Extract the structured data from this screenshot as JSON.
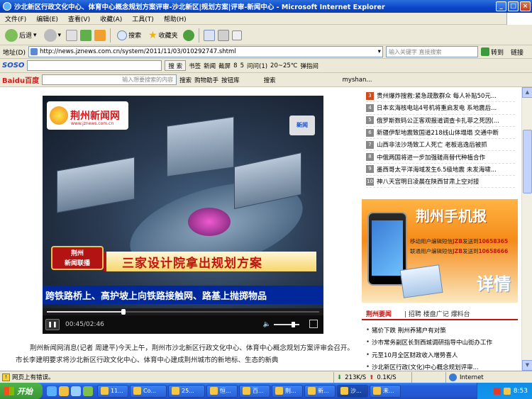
{
  "window": {
    "title": "沙北新区行政文化中心、体育中心概念规划方案评审-沙北新区|规划方案|评审-新闻中心 - Microsoft Internet Explorer"
  },
  "menu": [
    "文件(F)",
    "编辑(E)",
    "查看(V)",
    "收藏(A)",
    "工具(T)",
    "帮助(H)"
  ],
  "toolbar": {
    "back": "后退",
    "search": "搜索",
    "favorites": "收藏夹"
  },
  "address": {
    "label": "地址(D)",
    "url": "http://news.jznews.com.cn/system/2011/11/03/010292747.shtml",
    "search_placeholder": "输入关键字 直接搜索",
    "go": "转到",
    "links": "链接"
  },
  "soso": {
    "logo": "SOSO",
    "search_btn": "搜 索",
    "items": [
      "书签",
      "新闻",
      "截屏",
      "8",
      "5",
      "问问(1)",
      "20~25℃",
      "弹指间"
    ]
  },
  "baidu": {
    "logo": "Baidu百度",
    "placeholder": "输入想要搜索的内容",
    "items": [
      "搜索",
      "购物助手",
      "按钮库",
      "搜索",
      "myshan..."
    ]
  },
  "video": {
    "station": "荆州新闻网",
    "station_url": "www.jznews.com.cn",
    "corner": "新闻",
    "badge": "荆州\n新闻联播",
    "headline": "三家设计院拿出规划方案",
    "ticker": "跨铁路桥上、高护坡上向铁路接触网、路基上抛掷物品",
    "time": "00:45/02:46",
    "progress": 0.28,
    "volume": 0.75
  },
  "article": {
    "text": "荆州新闻网消息(记者 周建平)今天上午，荆州市沙北新区行政文化中心、体育中心概念规划方案评审会召开。市长李建明要求将沙北新区行政文化中心、体育中心建成荆州城市的新地标、生态的新典"
  },
  "news_list": [
    {
      "num": "3",
      "text": "贵州爆炸搜救:紧急疏散群众 每人补贴50元..."
    },
    {
      "num": "4",
      "text": "日本玄海核电站4号机将重启发电 系地震后..."
    },
    {
      "num": "5",
      "text": "俄罗斯数码公正客观报道调查卡扎菲之死因(..."
    },
    {
      "num": "6",
      "text": "新疆伊犁地震致国道218线山体塌塌 交通中断"
    },
    {
      "num": "7",
      "text": "山西非法沙场致工人死亡 老板逃逸后被抓"
    },
    {
      "num": "8",
      "text": "中俄两国将进一步加强磋商替代种植合作"
    },
    {
      "num": "9",
      "text": "墨西哥太平洋海域发生6.5级地震 未发海啸..."
    },
    {
      "num": "10",
      "text": "神八天宫明日凌晨在陕西甘肃上空对接"
    }
  ],
  "ad": {
    "title": "荆州手机报",
    "line1_prefix": "移动用户编辑短信",
    "line1_code": "JZB",
    "line1_mid": "发送到",
    "line1_num": "10658365",
    "line2_prefix": "联通用户编辑短信",
    "line2_code": "JZB",
    "line2_mid": "发送到",
    "line2_num": "10658666",
    "detail": "详情"
  },
  "jz": {
    "title": "荆州要闻",
    "links": "| 招聘 楼盘广记 爆料台",
    "items": [
      "猪价下跌 荆州养猪户有对策",
      "沙市常务副区长到西城调研指导中山街办工作",
      "元至10月全区财政收入增势喜人",
      "沙北新区行政(文化)中心概念规划评审..."
    ]
  },
  "status": {
    "text": "网页上有错误。",
    "speed_down": "213K/S",
    "speed_up": "0.1K/S",
    "zone": "Internet"
  },
  "taskbar": {
    "start": "开始",
    "tasks": [
      "11...",
      "Co...",
      "25...",
      "恒...",
      "百...",
      "荆...",
      "新...",
      "沙...",
      "未..."
    ],
    "time": "8:53"
  }
}
